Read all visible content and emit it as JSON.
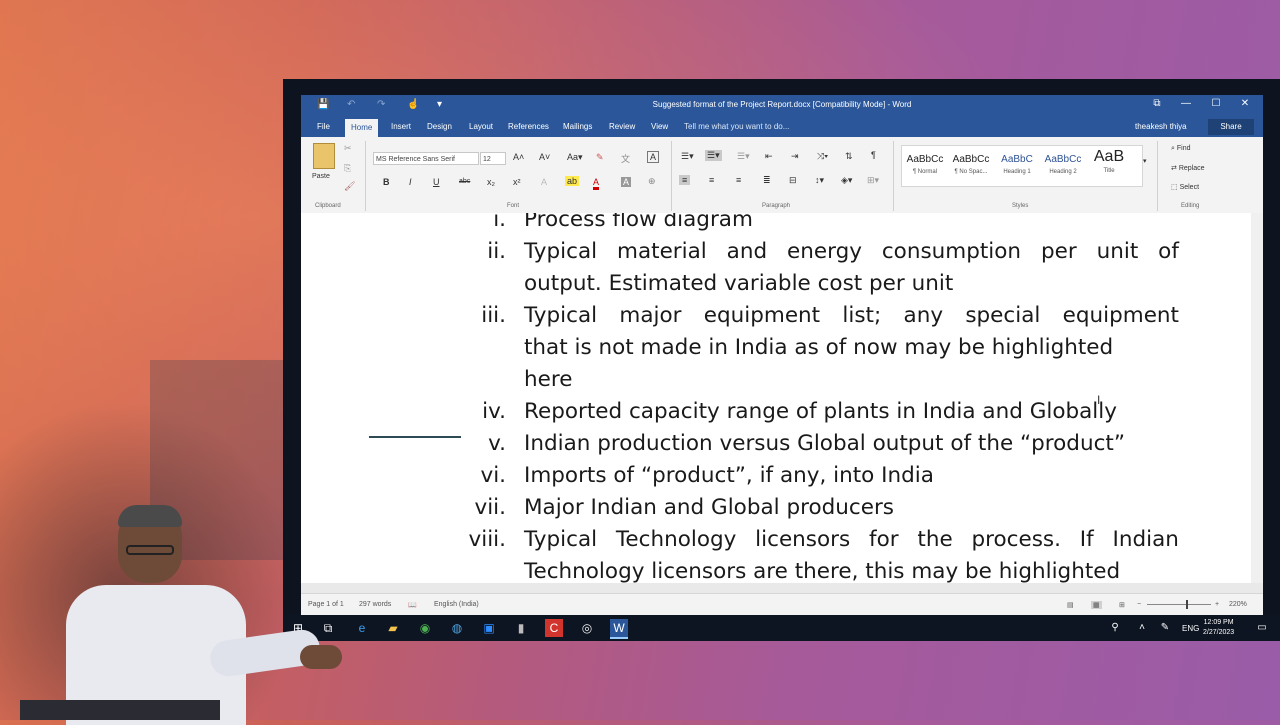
{
  "window": {
    "title": "Suggested format of the Project Report.docx [Compatibility Mode] - Word",
    "controls": [
      "⧉",
      "—",
      "☐",
      "✕"
    ]
  },
  "quick_access": {
    "save_icon": "💾",
    "undo_icon": "↶",
    "redo_icon": "↷",
    "touch_icon": "☝",
    "more_icon": "▾"
  },
  "tabs": [
    "File",
    "Home",
    "Insert",
    "Design",
    "Layout",
    "References",
    "Mailings",
    "Review",
    "View"
  ],
  "tell_me": "Tell me what you want to do...",
  "user": "theakesh thiya",
  "share": "Share",
  "ribbon": {
    "clipboard": {
      "paste": "Paste",
      "label": "Clipboard"
    },
    "font": {
      "name": "MS Reference Sans Serif",
      "size": "12",
      "label": "Font",
      "buttons": [
        "B",
        "I",
        "U",
        "abc",
        "x₂",
        "x²",
        "A",
        "A"
      ]
    },
    "paragraph": {
      "label": "Paragraph",
      "pilcrow": "¶"
    },
    "styles": {
      "label": "Styles",
      "items": [
        {
          "sample": "AaBbCc",
          "name": "¶ Normal"
        },
        {
          "sample": "AaBbCc",
          "name": "¶ No Spac..."
        },
        {
          "sample": "AaBbC",
          "name": "Heading 1"
        },
        {
          "sample": "AaBbCc",
          "name": "Heading 2"
        },
        {
          "sample": "AaB",
          "name": "Title"
        }
      ]
    },
    "editing": {
      "label": "Editing",
      "find": "Find",
      "replace": "Replace",
      "select": "Select"
    }
  },
  "document": {
    "items": [
      {
        "num": "i.",
        "lines": [
          "Process flow diagram"
        ]
      },
      {
        "num": "ii.",
        "lines": [
          "Typical material and energy consumption per unit of",
          "output. Estimated variable cost per unit"
        ]
      },
      {
        "num": "iii.",
        "lines": [
          "Typical major equipment list; any special equipment",
          "that is not made in India as of now may be highlighted",
          "here"
        ]
      },
      {
        "num": "iv.",
        "lines": [
          "Reported capacity range of plants in India and Globally"
        ]
      },
      {
        "num": "v.",
        "lines": [
          "Indian production versus Global output of the “product”"
        ]
      },
      {
        "num": "vi.",
        "lines": [
          "Imports of “product”, if any, into India"
        ]
      },
      {
        "num": "vii.",
        "lines": [
          "Major Indian and Global producers"
        ]
      },
      {
        "num": "viii.",
        "lines": [
          "Typical Technology licensors for the process. If Indian",
          "Technology licensors are there, this may be highlighted"
        ]
      }
    ]
  },
  "status_bar": {
    "page": "Page 1 of 1",
    "words": "297 words",
    "language": "English (India)",
    "zoom": "220%"
  },
  "taskbar": {
    "lang": "ENG",
    "time": "12:09 PM",
    "date": "2/27/2023"
  }
}
